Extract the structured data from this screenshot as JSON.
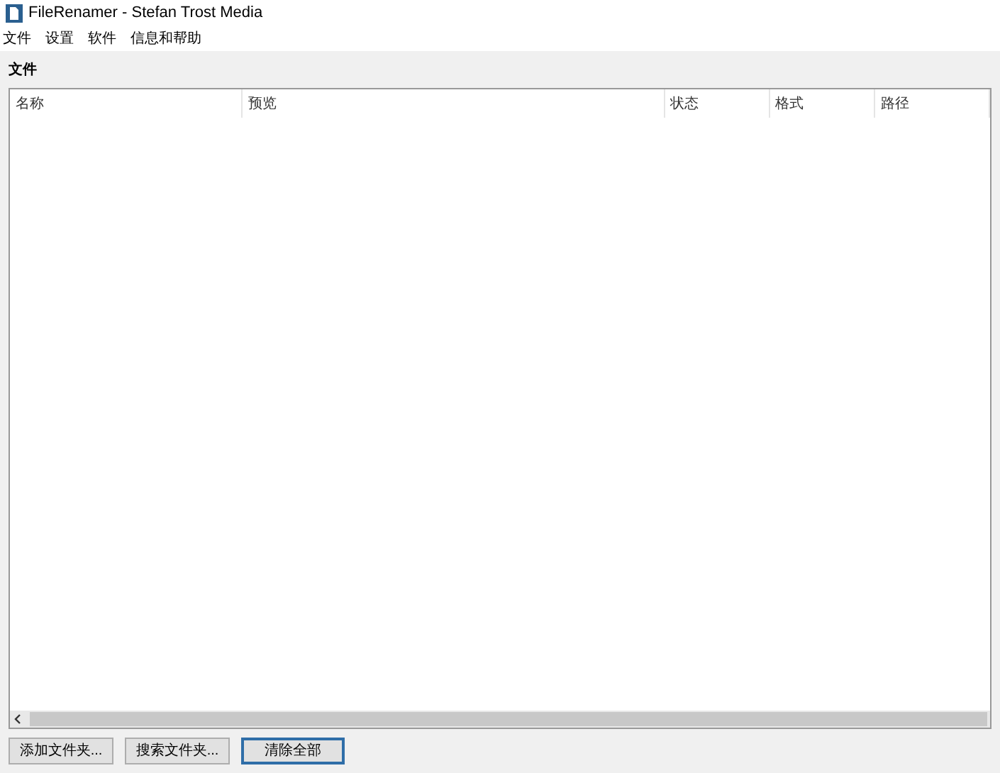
{
  "window": {
    "title": "FileRenamer - Stefan Trost Media"
  },
  "menu": [
    "文件",
    "设置",
    "软件",
    "信息和帮助"
  ],
  "section": {
    "title": "文件"
  },
  "table": {
    "columns": [
      "名称",
      "预览",
      "状态",
      "格式",
      "路径"
    ]
  },
  "buttons": [
    {
      "label": "添加文件夹...",
      "focused": false
    },
    {
      "label": "搜索文件夹...",
      "focused": false
    },
    {
      "label": "清除全部",
      "focused": true
    }
  ]
}
